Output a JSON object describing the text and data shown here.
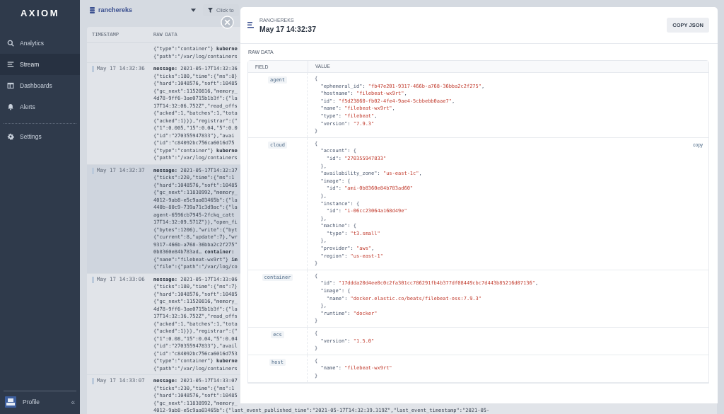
{
  "sidebar": {
    "logo": "AXIOM",
    "nav": [
      {
        "label": "Analytics",
        "selected": false
      },
      {
        "label": "Stream",
        "selected": true
      },
      {
        "label": "Dashboards",
        "selected": false
      },
      {
        "label": "Alerts",
        "selected": false
      }
    ],
    "settings": {
      "label": "Settings",
      "selected": false
    },
    "profile": {
      "label": "Profile",
      "collapse": "«"
    }
  },
  "stream": {
    "dataset": "ranchereks",
    "filter_button": "Click to",
    "columns": [
      "TIMESTAMP",
      "RAW DATA"
    ],
    "rows": [
      {
        "selected": false,
        "lines": [
          "{\"type\":\"container\"} **kuberne**",
          "{\"path\":\"/var/log/containers"
        ]
      },
      {
        "timestamp": "May 17 14:32:36",
        "selected": false,
        "lines": [
          "**message:** 2021-05-17T14:32:36",
          "{\"ticks\":180,\"time\":{\"ms\":8}",
          "{\"hard\":1048576,\"soft\":10485",
          "{\"gc_next\":11520816,\"memory_",
          "4d78-9ff6-3ae0715b1b3f\":{\"la",
          "17T14:32:06.752Z\",\"read_offs",
          "{\"acked\":1,\"batches\":1,\"tota",
          "{\"acked\":1}}},\"registrar\":{\"",
          "{\"1\":0.005,\"15\":0.04,\"5\":0.0",
          "{\"id\":\"270355947833\"},\"avai",
          "{\"id\":\"c84092bc756ca6016d75",
          "{\"type\":\"container\"} **kuberne**",
          "{\"path\":\"/var/log/containers"
        ]
      },
      {
        "timestamp": "May 17 14:32:37",
        "selected": true,
        "lines": [
          "**message:** 2021-05-17T14:32:37",
          "{\"ticks\":220,\"time\":{\"ms\":1",
          "{\"hard\":1048576,\"soft\":10485",
          "{\"gc_next\":11838992,\"memory_",
          "4012-9ab8-e5c9aa03465b\":{\"la",
          "440b-80c9-739a71c3d9ac\":{\"la",
          "agent-6596cb7945-2fckq_catt",
          "17T14:32:09.571Z\"}},\"open_fi",
          "{\"bytes\":1206},\"write\":{\"byt",
          "{\"current\":8,\"update\":7},\"wr",
          "9317-466b-a768-36bba2c2f275\"",
          "0b8360e84b783ad… **container:**",
          "{\"name\":\"filebeat-wx9rt\"} **im**",
          "{\"file\":{\"path\":\"/var/log/co"
        ]
      },
      {
        "timestamp": "May 17 14:33:06",
        "selected": false,
        "lines": [
          "**message:** 2021-05-17T14:33:06",
          "{\"ticks\":180,\"time\":{\"ms\":7}",
          "{\"hard\":1048576,\"soft\":10485",
          "{\"gc_next\":11520816,\"memory_",
          "4d78-9ff6-3ae0715b1b3f\":{\"la",
          "17T14:32:36.752Z\",\"read_offs",
          "{\"acked\":1,\"batches\":1,\"tota",
          "{\"acked\":1}}},\"registrar\":{\"",
          "{\"1\":0.08,\"15\":0.04,\"5\":0.04",
          "{\"id\":\"270355947833\"},\"avail",
          "{\"id\":\"c84092bc756ca6016d753",
          "{\"type\":\"container\"} **kuberne**",
          "{\"path\":\"/var/log/containers"
        ]
      },
      {
        "timestamp": "May 17 14:33:07",
        "selected": false,
        "lines": [
          "**message:** 2021-05-17T14:33:07",
          "{\"ticks\":230,\"time\":{\"ms\":1",
          "{\"hard\":1048576,\"soft\":10485",
          "{\"gc_next\":11838992,\"memory_",
          "4012-9ab8-e5c9aa03465b\":{\"last_event_published_time\":\"2021-05-17T14:32:39.319Z\",\"last_event_timestamp\":\"2021-05-"
        ]
      }
    ]
  },
  "panel": {
    "dataset": "RANCHEREKS",
    "timestamp": "May 17 14:32:37",
    "copy_button": "COPY JSON",
    "section": "RAW DATA",
    "columns": [
      "FIELD",
      "VALUE"
    ],
    "fields": [
      {
        "name": "agent",
        "lines": [
          {
            "code": "{"
          },
          {
            "code": "  \"ephemeral_id\": ",
            "string": "\"fb47e201-9317-466b-a768-36bba2c2f275\"",
            "end": ","
          },
          {
            "code": "  \"hostname\": ",
            "string": "\"filebeat-wx9rt\"",
            "end": ","
          },
          {
            "code": "  \"id\": ",
            "string": "\"f5d23860-fb02-4fe4-9ae4-5cbbebb0aae7\"",
            "end": ","
          },
          {
            "code": "  \"name\": ",
            "string": "\"filebeat-wx9rt\"",
            "end": ","
          },
          {
            "code": "  \"type\": ",
            "string": "\"filebeat\"",
            "end": ","
          },
          {
            "code": "  \"version\": ",
            "string": "\"7.9.3\""
          },
          {
            "code": "}"
          }
        ]
      },
      {
        "name": "cloud",
        "copy_link": "copy",
        "lines": [
          {
            "code": "{"
          },
          {
            "code": "  \"account\": {"
          },
          {
            "code": "    \"id\": ",
            "string": "\"270355947833\""
          },
          {
            "code": "  },"
          },
          {
            "code": "  \"availability_zone\": ",
            "string": "\"us-east-1c\"",
            "end": ","
          },
          {
            "code": "  \"image\": {"
          },
          {
            "code": "    \"id\": ",
            "string": "\"ami-0b8360e84b783ad60\""
          },
          {
            "code": "  },"
          },
          {
            "code": "  \"instance\": {"
          },
          {
            "code": "    \"id\": ",
            "string": "\"i-06cc23064a168d49e\""
          },
          {
            "code": "  },"
          },
          {
            "code": "  \"machine\": {"
          },
          {
            "code": "    \"type\": ",
            "string": "\"t3.small\""
          },
          {
            "code": "  },"
          },
          {
            "code": "  \"provider\": ",
            "string": "\"aws\"",
            "end": ","
          },
          {
            "code": "  \"region\": ",
            "string": "\"us-east-1\""
          },
          {
            "code": "}"
          }
        ]
      },
      {
        "name": "container",
        "lines": [
          {
            "code": "{"
          },
          {
            "code": "  \"id\": ",
            "string": "\"17ddda20d4ee0c0c2fa301cc786291fb4b377df08449cbc7d443b85216d07136\"",
            "end": ","
          },
          {
            "code": "  \"image\": {"
          },
          {
            "code": "    \"name\": ",
            "string": "\"docker.elastic.co/beats/filebeat-oss:7.9.3\""
          },
          {
            "code": "  },"
          },
          {
            "code": "  \"runtime\": ",
            "string": "\"docker\""
          },
          {
            "code": "}"
          }
        ]
      },
      {
        "name": "ecs",
        "lines": [
          {
            "code": "{"
          },
          {
            "code": "  \"version\": ",
            "string": "\"1.5.0\""
          },
          {
            "code": "}"
          }
        ]
      },
      {
        "name": "host",
        "lines": [
          {
            "code": "{"
          },
          {
            "code": "  \"name\": ",
            "string": "\"filebeat-wx9rt\""
          },
          {
            "code": "}"
          }
        ]
      }
    ]
  }
}
